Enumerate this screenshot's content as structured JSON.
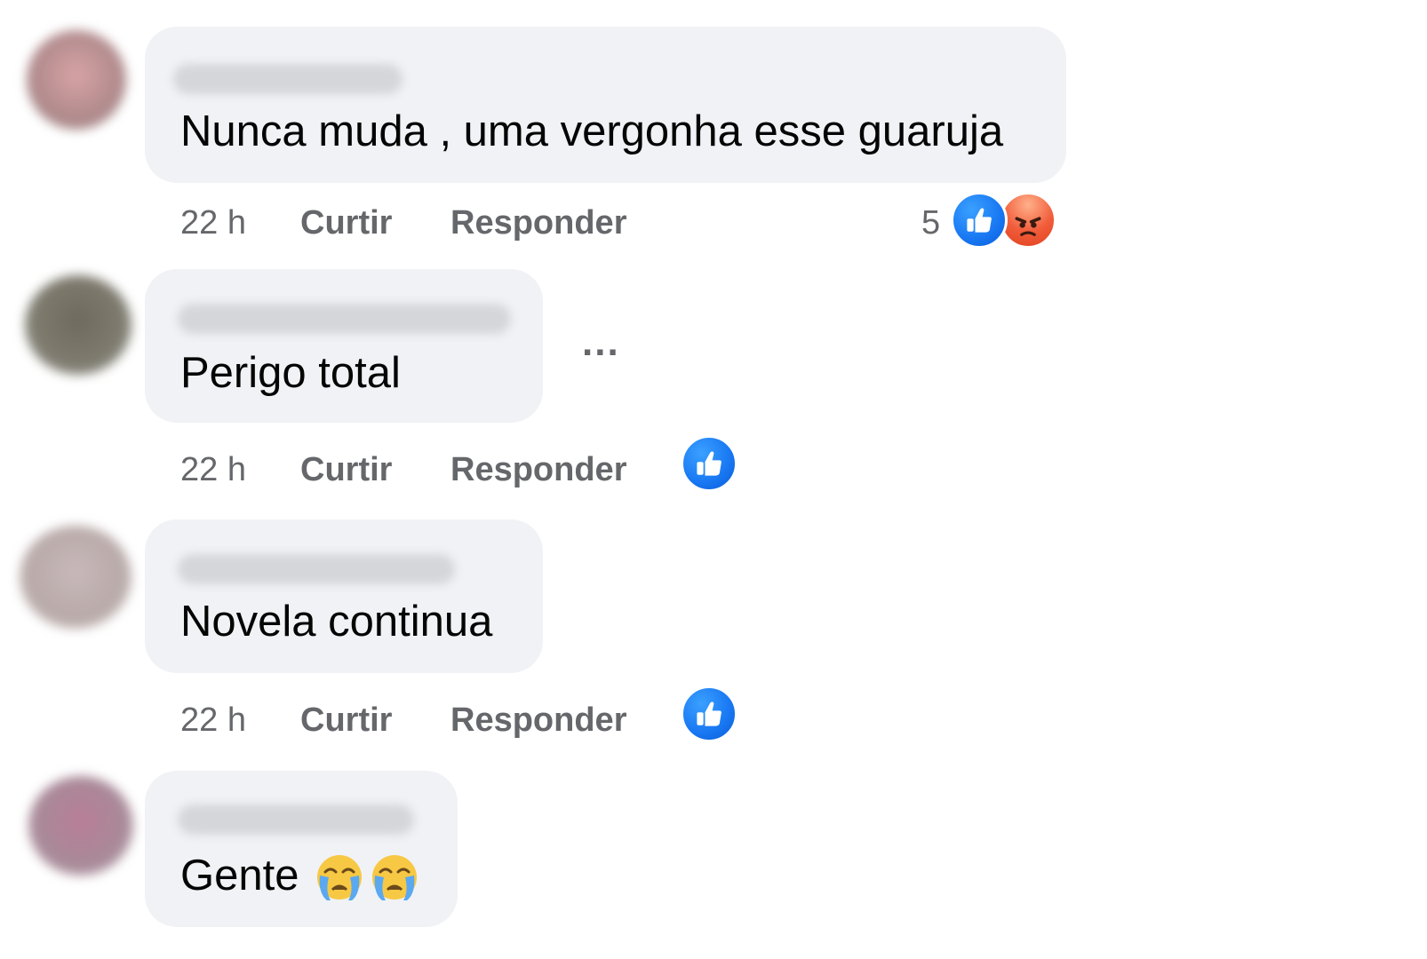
{
  "comments": [
    {
      "text": "Nunca muda , uma vergonha esse guaruja",
      "time": "22 h",
      "like_label": "Curtir",
      "reply_label": "Responder",
      "reaction_count": "5",
      "reactions": [
        "like-icon",
        "angry-icon"
      ],
      "avatar_color": "#c79a9e"
    },
    {
      "text": "Perigo total",
      "time": "22 h",
      "like_label": "Curtir",
      "reply_label": "Responder",
      "reactions": [
        "like-icon"
      ],
      "avatar_color": "#7a7366",
      "more_options": "..."
    },
    {
      "text": "Novela continua",
      "time": "22 h",
      "like_label": "Curtir",
      "reply_label": "Responder",
      "reactions": [
        "like-icon"
      ],
      "avatar_color": "#bfb2b4"
    },
    {
      "text": "Gente",
      "emoji": [
        "crying-face-emoji",
        "crying-face-emoji"
      ],
      "avatar_color": "#b88aa0"
    }
  ],
  "colors": {
    "bubble": "#f0f2f5",
    "meta_text": "#65676b",
    "like_blue": "#1877f2",
    "angry_orange": "#f15c3a"
  }
}
